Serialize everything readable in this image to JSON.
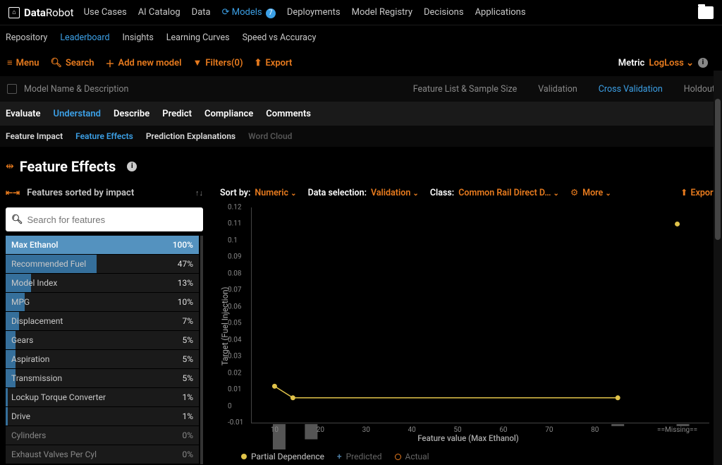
{
  "logo": {
    "bold": "Data",
    "light": "Robot"
  },
  "top_nav": {
    "items": [
      "Use Cases",
      "AI Catalog",
      "Data",
      "Models",
      "Deployments",
      "Model Registry",
      "Decisions",
      "Applications"
    ],
    "active_index": 3,
    "models_badge": "7"
  },
  "sub_nav": {
    "items": [
      "Repository",
      "Leaderboard",
      "Insights",
      "Learning Curves",
      "Speed vs Accuracy"
    ],
    "active_index": 1
  },
  "toolbar": {
    "menu": "Menu",
    "search": "Search",
    "add": "Add new model",
    "filters": "Filters(0)",
    "export": "Export",
    "metric_label": "Metric",
    "metric_value": "LogLoss"
  },
  "header_row": {
    "name_col": "Model Name & Description",
    "feature_col": "Feature List & Sample Size",
    "validation": "Validation",
    "cross_validation": "Cross Validation",
    "holdout": "Holdout"
  },
  "tabs1": [
    "Evaluate",
    "Understand",
    "Describe",
    "Predict",
    "Compliance",
    "Comments"
  ],
  "tabs1_active": 1,
  "tabs2": [
    {
      "label": "Feature Impact",
      "state": "normal"
    },
    {
      "label": "Feature Effects",
      "state": "active"
    },
    {
      "label": "Prediction Explanations",
      "state": "normal"
    },
    {
      "label": "Word Cloud",
      "state": "disabled"
    }
  ],
  "page_title": "Feature Effects",
  "feature_panel": {
    "title": "Features sorted by impact",
    "search_placeholder": "Search for features",
    "items": [
      {
        "name": "Max Ethanol",
        "pct": "100%",
        "bar": 100,
        "selected": true
      },
      {
        "name": "Recommended Fuel",
        "pct": "47%",
        "bar": 47
      },
      {
        "name": "Model Index",
        "pct": "13%",
        "bar": 13
      },
      {
        "name": "MPG",
        "pct": "10%",
        "bar": 10
      },
      {
        "name": "Displacement",
        "pct": "7%",
        "bar": 7
      },
      {
        "name": "Gears",
        "pct": "5%",
        "bar": 5
      },
      {
        "name": "Aspiration",
        "pct": "5%",
        "bar": 5
      },
      {
        "name": "Transmission",
        "pct": "5%",
        "bar": 5
      },
      {
        "name": "Lockup Torque Converter",
        "pct": "1%",
        "bar": 1
      },
      {
        "name": "Drive",
        "pct": "1%",
        "bar": 1
      },
      {
        "name": "Cylinders",
        "pct": "0%",
        "bar": 0,
        "dim": true
      },
      {
        "name": "Exhaust Valves Per Cyl",
        "pct": "0%",
        "bar": 0,
        "dim": true
      }
    ]
  },
  "chart_toolbar": {
    "sort_by_label": "Sort by:",
    "sort_by_value": "Numeric",
    "data_selection_label": "Data selection:",
    "data_selection_value": "Validation",
    "class_label": "Class:",
    "class_value": "Common Rail Direct D…",
    "more": "More",
    "export": "Export"
  },
  "legend": {
    "partial": "Partial Dependence",
    "predicted": "Predicted",
    "actual": "Actual"
  },
  "chart_data": {
    "type": "line",
    "title": "",
    "xlabel": "Feature value (Max Ethanol)",
    "ylabel": "Target (Fuel Injection)",
    "ylim": [
      -0.01,
      0.12
    ],
    "yticks": [
      -0.01,
      0,
      0.01,
      0.02,
      0.03,
      0.04,
      0.05,
      0.06,
      0.07,
      0.08,
      0.09,
      0.1,
      0.11,
      0.12
    ],
    "x_numeric_ticks": [
      10,
      20,
      30,
      40,
      50,
      60,
      70,
      80
    ],
    "missing_label": "==Missing==",
    "series": [
      {
        "name": "Partial Dependence",
        "color": "#e0c34a",
        "points": [
          {
            "x": 10,
            "y": 0.012
          },
          {
            "x": 14,
            "y": 0.005
          },
          {
            "x": 85,
            "y": 0.005
          }
        ],
        "missing_point": {
          "y": 0.11
        }
      }
    ],
    "histogram": [
      {
        "x_center": 11,
        "w": 7,
        "h_rel": 1.0
      },
      {
        "x_center": 18,
        "w": 7,
        "h_rel": 0.6
      },
      {
        "x_center": 85,
        "w": 7,
        "h_rel": 0.08
      },
      {
        "x_center": 92,
        "w": 7,
        "h_rel": 0.08
      }
    ]
  }
}
